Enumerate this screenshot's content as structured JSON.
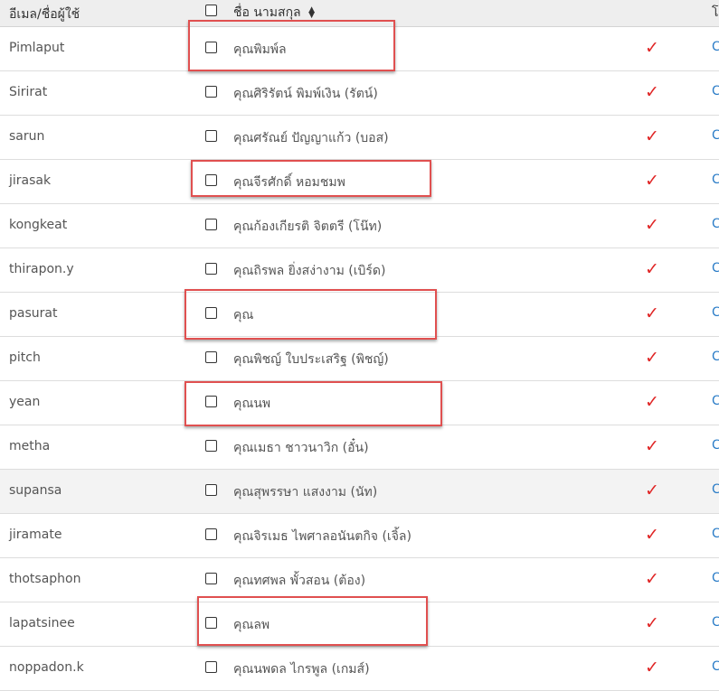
{
  "header": {
    "col_user": "อีเมล/ชื่อผู้ใช้",
    "col_name": "ชื่อ นามสกุล",
    "col_last": "โ",
    "sort_icon": "sort-icon"
  },
  "rows": [
    {
      "user": "Pimlaput",
      "name": "คุณพิมพ์ล",
      "check": "✓",
      "act": "C"
    },
    {
      "user": "Sirirat",
      "name": "คุณศิริรัตน์ พิมพ์เงิน (รัตน์)",
      "check": "✓",
      "act": "C"
    },
    {
      "user": "sarun",
      "name": "คุณศรัณย์ ปัญญาแก้ว (บอส)",
      "check": "✓",
      "act": "C"
    },
    {
      "user": "jirasak",
      "name": "คุณจีรศักดิ์ หอมชมพ",
      "check": "✓",
      "act": "C"
    },
    {
      "user": "kongkeat",
      "name": "คุณก้องเกียรติ จิตตรี (โน๊ท)",
      "check": "✓",
      "act": "C"
    },
    {
      "user": "thirapon.y",
      "name": "คุณถิรพล ยิ่งสง่างาม (เบิร์ด)",
      "check": "✓",
      "act": "C"
    },
    {
      "user": "pasurat",
      "name": "คุณ",
      "check": "✓",
      "act": "C"
    },
    {
      "user": "pitch",
      "name": "คุณพิชญ์ ใบประเสริฐ (พิชญ์)",
      "check": "✓",
      "act": "C"
    },
    {
      "user": "yean",
      "name": "คุณนพ",
      "check": "✓",
      "act": "C"
    },
    {
      "user": "metha",
      "name": "คุณเมธา ชาวนาวิก (อั๋น)",
      "check": "✓",
      "act": "C"
    },
    {
      "user": "supansa",
      "name": "คุณสุพรรษา แสงงาม (นัท)",
      "check": "✓",
      "act": "C"
    },
    {
      "user": "jiramate",
      "name": "คุณจิรเมธ ไพศาลอนันตกิจ (เจิ้ล)",
      "check": "✓",
      "act": "C"
    },
    {
      "user": "thotsaphon",
      "name": "คุณทศพล พั้วสอน (ต้อง)",
      "check": "✓",
      "act": "C"
    },
    {
      "user": "lapatsinee",
      "name": "คุณลพ",
      "check": "✓",
      "act": "C"
    },
    {
      "user": "noppadon.k",
      "name": "คุณนพดล ไกรพูล (เกมส์)",
      "check": "✓",
      "act": "C"
    }
  ],
  "colors": {
    "check": "#e02525",
    "highlight_box": "#e05050",
    "header_bg": "#eeeeee",
    "hover_row": "#f3f3f3",
    "link": "#2a7cc7"
  }
}
